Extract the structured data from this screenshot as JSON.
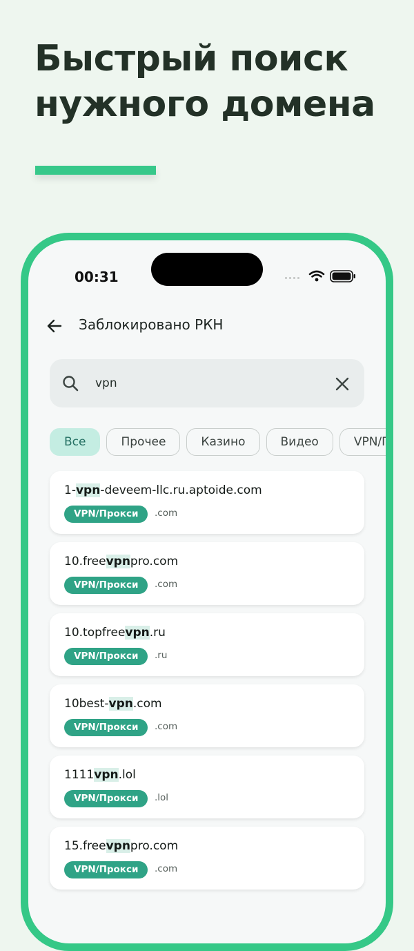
{
  "promo": {
    "title_line1": "Быстрый поиск",
    "title_line2": "нужного домена"
  },
  "status_bar": {
    "time": "00:31"
  },
  "header": {
    "title": "Заблокировано РКН"
  },
  "search": {
    "value": "vpn"
  },
  "filters": [
    {
      "label": "Все",
      "active": true
    },
    {
      "label": "Прочее",
      "active": false
    },
    {
      "label": "Казино",
      "active": false
    },
    {
      "label": "Видео",
      "active": false
    },
    {
      "label": "VPN/Прокси",
      "active": false
    }
  ],
  "results": [
    {
      "prefix": "1-",
      "match": "vpn",
      "suffix": "-deveem-llc.ru.aptoide.com",
      "category": "VPN/Прокси",
      "tld": ".com"
    },
    {
      "prefix": "10.free",
      "match": "vpn",
      "suffix": "pro.com",
      "category": "VPN/Прокси",
      "tld": ".com"
    },
    {
      "prefix": "10.topfree",
      "match": "vpn",
      "suffix": ".ru",
      "category": "VPN/Прокси",
      "tld": ".ru"
    },
    {
      "prefix": "10best-",
      "match": "vpn",
      "suffix": ".com",
      "category": "VPN/Прокси",
      "tld": ".com"
    },
    {
      "prefix": "1111",
      "match": "vpn",
      "suffix": ".lol",
      "category": "VPN/Прокси",
      "tld": ".lol"
    },
    {
      "prefix": "15.free",
      "match": "vpn",
      "suffix": "pro.com",
      "category": "VPN/Прокси",
      "tld": ".com"
    }
  ],
  "colors": {
    "accent": "#35c887",
    "tag": "#2fa386",
    "chip_active_bg": "#c4ede2",
    "highlight": "#d9efe8"
  }
}
